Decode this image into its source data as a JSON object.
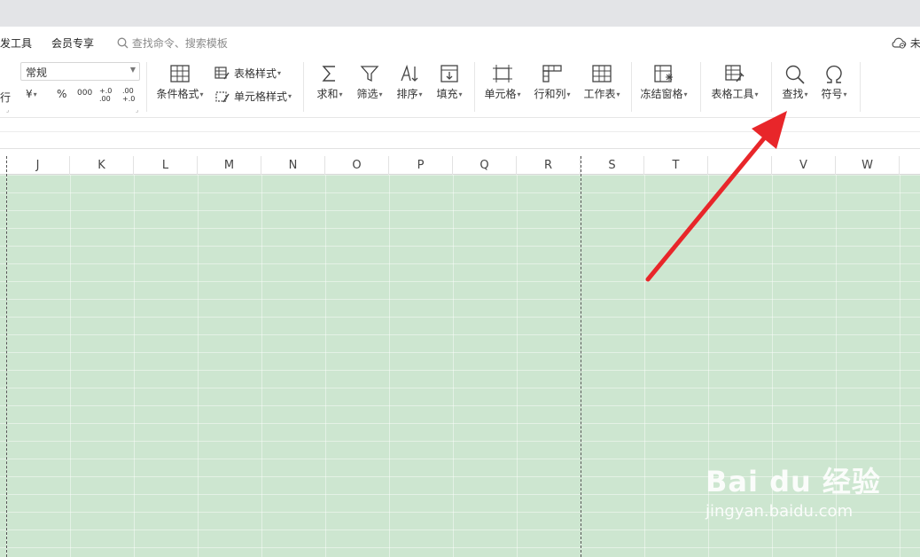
{
  "menubar": {
    "dev_tools_partial": "发工具",
    "member": "会员专享",
    "search_placeholder": "查找命令、搜索模板",
    "right_partial": "未"
  },
  "ribbon": {
    "left_partial_char": "行",
    "number_format": "常规",
    "currency_symbol": "¥",
    "percent_symbol": "%",
    "thousands_symbol": "000",
    "inc_decimal": "+.0 .00",
    "dec_decimal": ".00 +.0",
    "conditional_format": "条件格式",
    "table_style": "表格样式",
    "cell_style": "单元格样式",
    "sum": "求和",
    "filter": "筛选",
    "sort": "排序",
    "fill": "填充",
    "cell": "单元格",
    "row_col": "行和列",
    "worksheet": "工作表",
    "freeze_panes": "冻结窗格",
    "table_tools": "表格工具",
    "find": "查找",
    "symbol": "符号"
  },
  "columns": [
    "J",
    "K",
    "L",
    "M",
    "N",
    "O",
    "P",
    "Q",
    "R",
    "S",
    "T",
    "",
    "V",
    "W"
  ],
  "colors": {
    "grid_fill": "#cde6d0",
    "arrow": "#e8262a",
    "topstrip": "#e3e4e7"
  },
  "watermark": {
    "logo": "Bai du 经验",
    "url": "jingyan.baidu.com"
  }
}
